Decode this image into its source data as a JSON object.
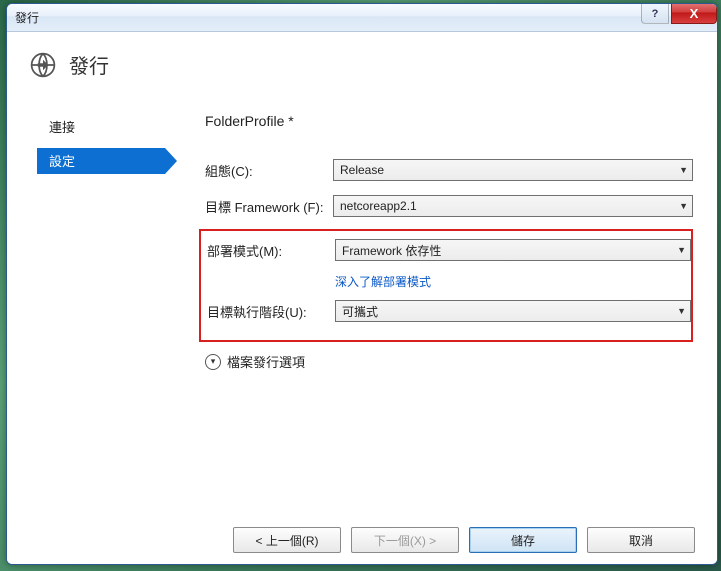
{
  "window": {
    "title": "發行"
  },
  "header": {
    "title": "發行"
  },
  "sidebar": {
    "items": [
      {
        "label": "連接"
      },
      {
        "label": "設定"
      }
    ]
  },
  "main": {
    "profile_title": "FolderProfile *",
    "fields": {
      "configuration_label": "組態(C):",
      "configuration_value": "Release",
      "framework_label": "目標 Framework (F):",
      "framework_value": "netcoreapp2.1",
      "deployment_label": "部署模式(M):",
      "deployment_value": "Framework 依存性",
      "deployment_link": "深入了解部署模式",
      "runtime_label": "目標執行階段(U):",
      "runtime_value": "可攜式"
    },
    "expander_label": "檔案發行選項"
  },
  "footer": {
    "prev": "< 上一個(R)",
    "next": "下一個(X) >",
    "save": "儲存",
    "cancel": "取消"
  },
  "winbuttons": {
    "help": "?",
    "close": "X"
  }
}
